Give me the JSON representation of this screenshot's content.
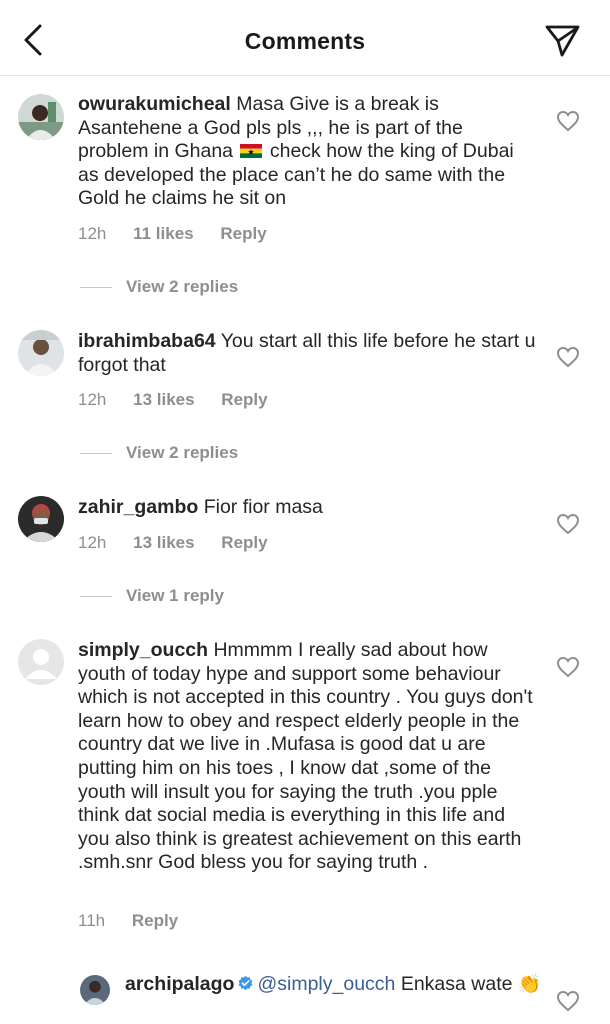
{
  "header": {
    "title": "Comments"
  },
  "comments": [
    {
      "username": "owurakumicheal",
      "text_before_flag": "Masa Give is a break is Asantehene a God pls pls ,,, he is part of the problem in Ghana ",
      "text_after_flag": " check how the king of Dubai as developed the place can’t he do same with the Gold he claims he sit on",
      "time": "12h",
      "likes": "11 likes",
      "reply": "Reply",
      "view_replies": "View 2 replies"
    },
    {
      "username": "ibrahimbaba64",
      "text": "You start all this life before he start u forgot that",
      "time": "12h",
      "likes": "13 likes",
      "reply": "Reply",
      "view_replies": "View 2 replies"
    },
    {
      "username": "zahir_gambo",
      "text": "Fior fior masa",
      "time": "12h",
      "likes": "13 likes",
      "reply": "Reply",
      "view_replies": "View 1 reply"
    },
    {
      "username": "simply_oucch",
      "text": "Hmmmm I really sad about how youth of today hype and support some behaviour which is not accepted in this country . You guys don't learn how to obey and respect elderly people in the  country dat we live in .Mufasa is good dat u are putting  him on his toes , I know dat ,some of the youth will insult you  for saying the truth .you pple think dat social media is everything in this life and you also think is greatest achievement on this earth .smh.snr God bless you for saying truth .",
      "time": "11h",
      "reply": "Reply"
    },
    {
      "username": "archipalago",
      "mention": "@simply_oucch",
      "text": "Enkasa wate",
      "emoji": "👏"
    }
  ],
  "icons": {
    "back": "chevron-left-icon",
    "send": "paper-plane-icon",
    "like": "heart-outline-icon",
    "verified": "verified-badge-icon",
    "flag": "ghana-flag-icon"
  },
  "colors": {
    "text": "#262626",
    "muted": "#8e8e8e",
    "mention": "#3b5e94",
    "verified": "#3897f0"
  }
}
